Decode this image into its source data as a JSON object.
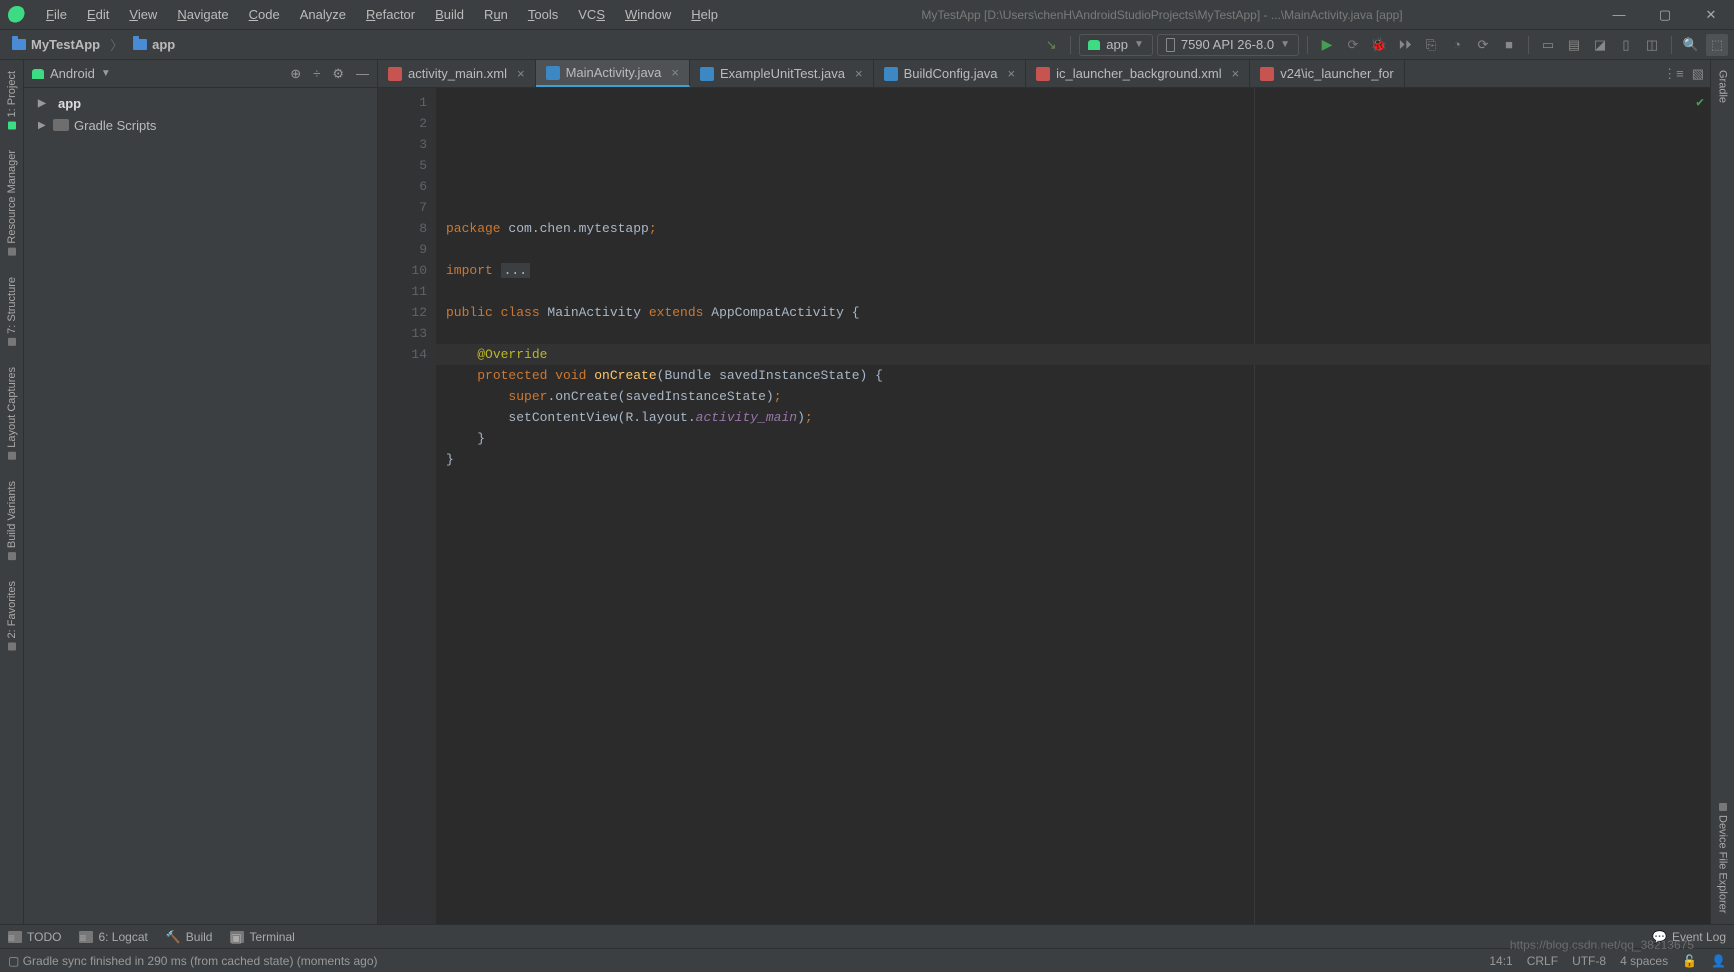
{
  "window": {
    "title": "MyTestApp [D:\\Users\\chenH\\AndroidStudioProjects\\MyTestApp] - ...\\MainActivity.java [app]"
  },
  "menu": {
    "file": "File",
    "edit": "Edit",
    "view": "View",
    "navigate": "Navigate",
    "code": "Code",
    "analyze": "Analyze",
    "refactor": "Refactor",
    "build": "Build",
    "run": "Run",
    "tools": "Tools",
    "vcs": "VCS",
    "window_m": "Window",
    "help": "Help"
  },
  "breadcrumb": {
    "seg1": "MyTestApp",
    "seg2": "app"
  },
  "runconfig": {
    "module": "app",
    "device": "7590 API 26-8.0"
  },
  "project_panel": {
    "title": "Android",
    "tree": {
      "app": "app",
      "gradle": "Gradle Scripts"
    }
  },
  "tabs": {
    "t1": "activity_main.xml",
    "t2": "MainActivity.java",
    "t3": "ExampleUnitTest.java",
    "t4": "BuildConfig.java",
    "t5": "ic_launcher_background.xml",
    "t6": "v24\\ic_launcher_for"
  },
  "code": {
    "l1_kw": "package",
    "l1_rest": " com.chen.mytestapp",
    "l1_sc": ";",
    "l3_kw": "import ",
    "l3_rest": "...",
    "l6_a": "public class ",
    "l6_b": "MainActivity ",
    "l6_c": "extends ",
    "l6_d": "AppCompatActivity {",
    "l8": "@Override",
    "l9_a": "protected void ",
    "l9_b": "onCreate",
    "l9_c": "(Bundle savedInstanceState) {",
    "l10_a": "super",
    "l10_b": ".onCreate(savedInstanceState)",
    "l10_sc": ";",
    "l11_a": "setContentView(R.layout.",
    "l11_b": "activity_main",
    "l11_c": ")",
    "l11_sc": ";",
    "l12": "}",
    "l13": "}"
  },
  "leftstrip": {
    "project": "1: Project",
    "resmgr": "Resource Manager",
    "structure": "7: Structure",
    "layoutcap": "Layout Captures",
    "buildvar": "Build Variants",
    "fav": "2: Favorites"
  },
  "rightstrip": {
    "gradle": "Gradle",
    "explorer": "Device File Explorer"
  },
  "bottom": {
    "todo": "TODO",
    "logcat": "6: Logcat",
    "build": "Build",
    "terminal": "Terminal",
    "eventlog": "Event Log"
  },
  "status": {
    "msg": "Gradle sync finished in 290 ms (from cached state) (moments ago)",
    "pos": "14:1",
    "crlf": "CRLF",
    "enc": "UTF-8",
    "indent": "4 spaces",
    "watermark": "https://blog.csdn.net/qq_38213675"
  }
}
